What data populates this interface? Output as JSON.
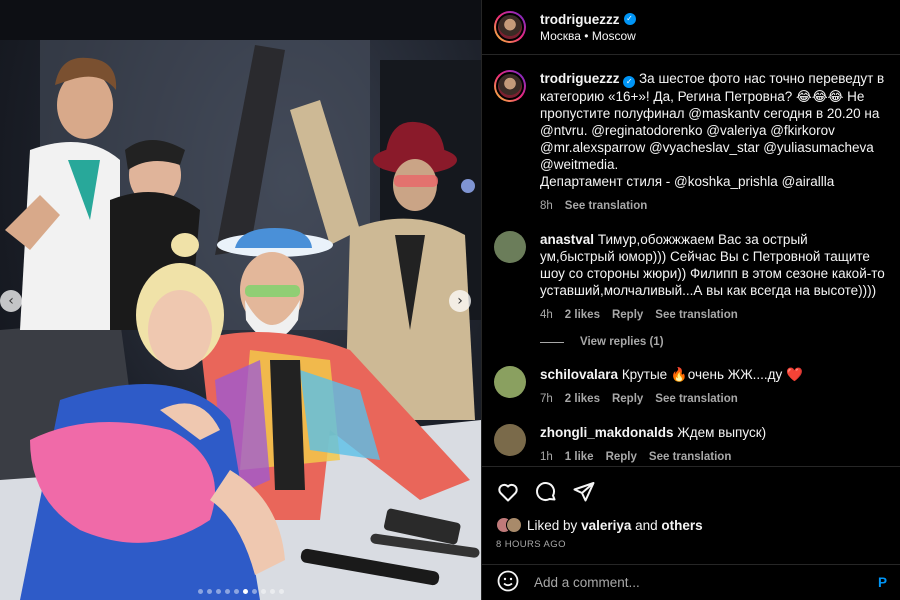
{
  "post": {
    "author": "trodriguezzz",
    "location": "Москва • Moscow",
    "caption_text": "За шестое фото нас точно переведут в категорию «16+»! Да, Регина Петровна? 😂😂😂 Не пропустите полуфинал @maskantv сегодня в 20.20 на @ntvru. @reginatodorenko @valeriya @fkirkorov @mr.alexsparrow @vyacheslav_star @yuliasumacheva @weitmedia.",
    "caption_line2": "Департамент стиля - @koshka_prishla @airallla",
    "caption_time": "8h",
    "see_translation": "See translation"
  },
  "comments": [
    {
      "user": "anastval",
      "text": "Тимур,обожжжаем Вас за острый ум,быстрый юмор))) Сейчас Вы с Петровной тащите шоу со стороны жюри)) Филипп в этом сезоне какой-то уставший,молчаливый...А вы как всегда на высоте))))",
      "time": "4h",
      "likes": "2 likes",
      "reply": "Reply",
      "translate": "See translation",
      "avatar_color": "#6b7d5a"
    },
    {
      "user": "schilovalara",
      "text": "Крутые 🔥очень ЖЖ....ду ❤️",
      "time": "7h",
      "likes": "2 likes",
      "reply": "Reply",
      "translate": "See translation",
      "avatar_color": "#8aa060"
    },
    {
      "user": "zhongli_makdonalds",
      "text": "Ждем выпуск)",
      "time": "1h",
      "likes": "1 like",
      "reply": "Reply",
      "translate": "See translation",
      "avatar_color": "#7a6a4a"
    }
  ],
  "view_replies": "View replies (1)",
  "likes": {
    "prefix": "Liked by",
    "user": "valeriya",
    "and": "and",
    "others": "others"
  },
  "time_ago": "8 HOURS AGO",
  "add_comment": {
    "placeholder": "Add a comment...",
    "post_label": "P"
  },
  "carousel": {
    "prev_icon": "‹",
    "next_icon": "›",
    "dot_count": 10,
    "active_dot": 5
  },
  "colors": {
    "accent": "#0095f6",
    "background": "#000000",
    "muted_text": "#a8a8a8",
    "divider": "#262626"
  },
  "icons": [
    "heart-icon",
    "comment-icon",
    "share-icon",
    "emoji-icon",
    "verified-icon",
    "chevron-left-icon",
    "chevron-right-icon"
  ]
}
